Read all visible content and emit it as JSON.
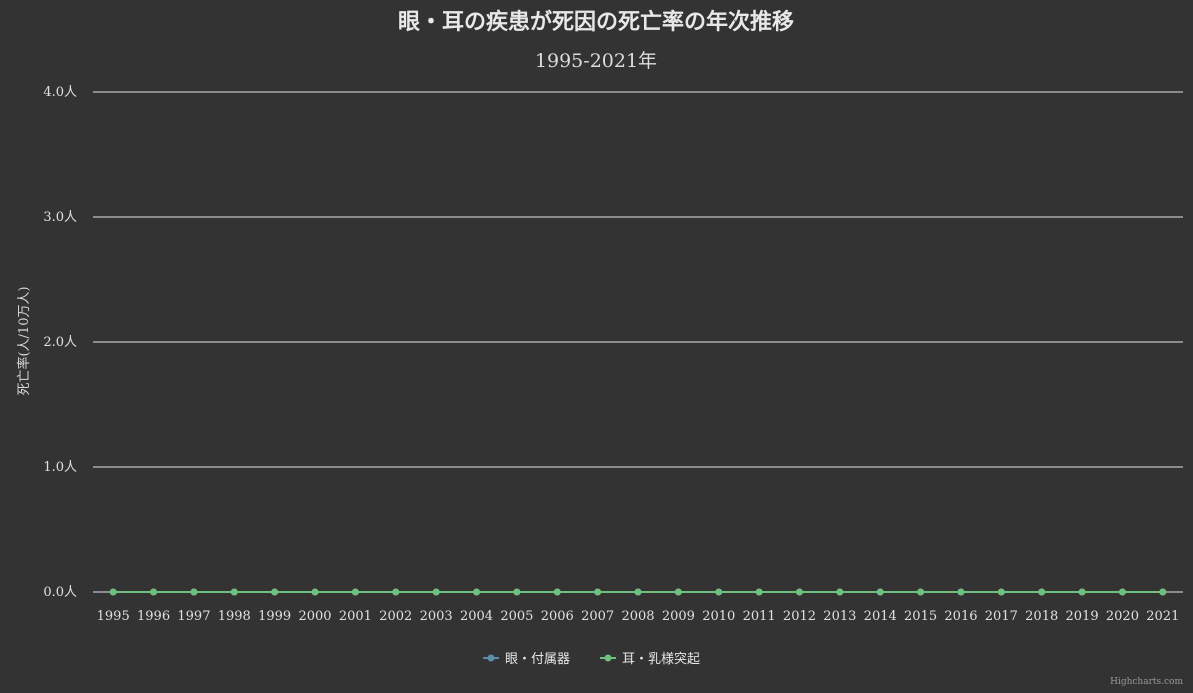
{
  "chart_data": {
    "type": "line",
    "title": "眼・耳の疾患が死因の死亡率の年次推移",
    "subtitle": "1995-2021年",
    "ylabel": "死亡率(人/10万人)",
    "ylim": [
      0,
      4
    ],
    "y_ticks": [
      "0.0人",
      "1.0人",
      "2.0人",
      "3.0人",
      "4.0人"
    ],
    "grid": true,
    "legend": "bottom-center",
    "categories": [
      "1995",
      "1996",
      "1997",
      "1998",
      "1999",
      "2000",
      "2001",
      "2002",
      "2003",
      "2004",
      "2005",
      "2006",
      "2007",
      "2008",
      "2009",
      "2010",
      "2011",
      "2012",
      "2013",
      "2014",
      "2015",
      "2016",
      "2017",
      "2018",
      "2019",
      "2020",
      "2021"
    ],
    "series": [
      {
        "name": "眼・付属器",
        "color": "#5b8fa8",
        "values": [
          0.0,
          0.0,
          0.0,
          0.0,
          0.0,
          0.0,
          0.0,
          0.0,
          0.0,
          0.0,
          0.0,
          0.0,
          0.0,
          0.0,
          0.0,
          0.0,
          0.0,
          0.0,
          0.0,
          0.0,
          0.0,
          0.0,
          0.0,
          0.0,
          0.0,
          0.0,
          0.0
        ]
      },
      {
        "name": "耳・乳様突起",
        "color": "#6fbf7f",
        "values": [
          0.0,
          0.0,
          0.0,
          0.0,
          0.0,
          0.0,
          0.0,
          0.0,
          0.0,
          0.0,
          0.0,
          0.0,
          0.0,
          0.0,
          0.0,
          0.0,
          0.0,
          0.0,
          0.0,
          0.0,
          0.0,
          0.0,
          0.0,
          0.0,
          0.0,
          0.0,
          0.0
        ]
      }
    ],
    "credits": "Highcharts.com"
  }
}
